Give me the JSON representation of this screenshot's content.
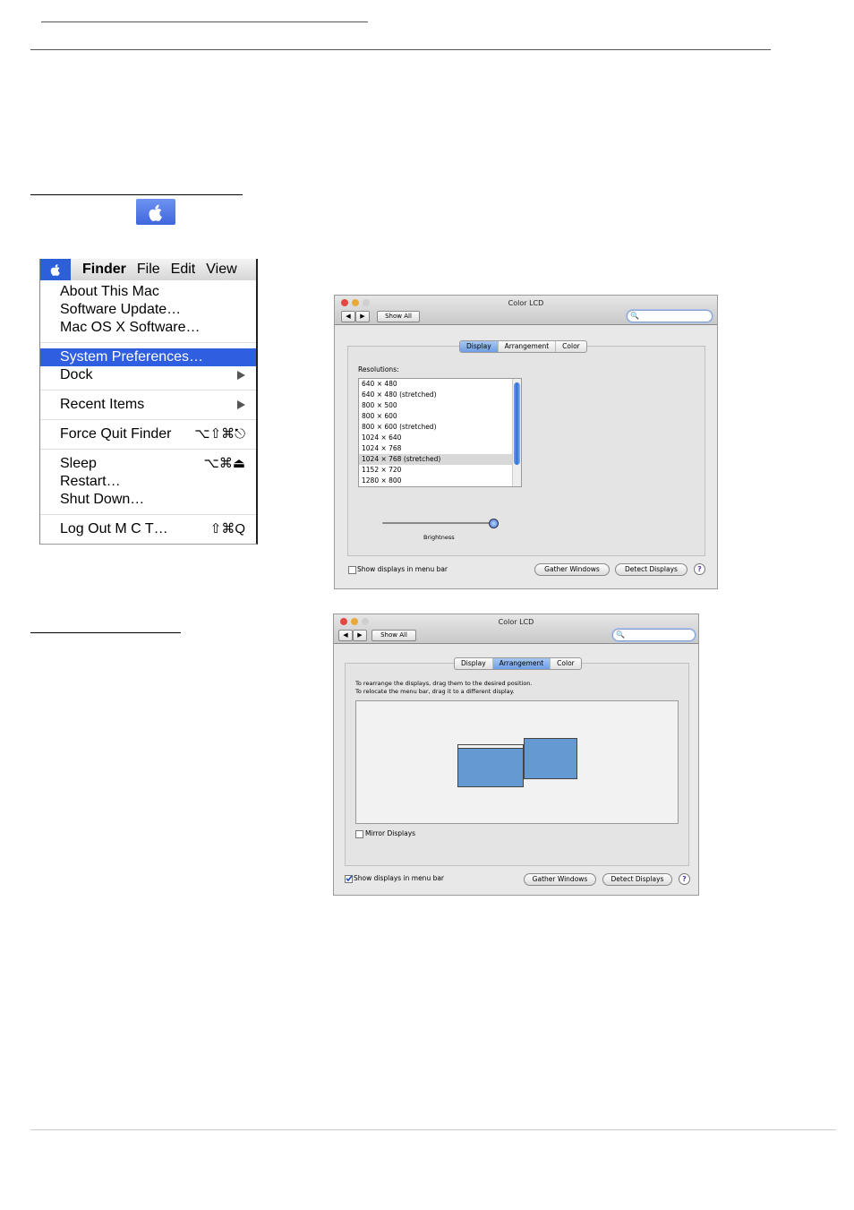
{
  "menu": {
    "bar": {
      "finder": "Finder",
      "file": "File",
      "edit": "Edit",
      "view": "View"
    },
    "items": [
      {
        "label": "About This Mac"
      },
      {
        "label": "Software Update…"
      },
      {
        "label": "Mac OS X Software…"
      },
      {
        "label": "System Preferences…"
      },
      {
        "label": "Dock"
      },
      {
        "label": "Recent Items"
      },
      {
        "label": "Force Quit Finder",
        "shortcut": "⌥⇧⌘⎋"
      },
      {
        "label": "Sleep",
        "shortcut": "⌥⌘⏏"
      },
      {
        "label": "Restart…"
      },
      {
        "label": "Shut Down…"
      },
      {
        "label": "Log Out M C T…",
        "shortcut": "⇧⌘Q"
      }
    ],
    "selected": "System Preferences…"
  },
  "display_window": {
    "title": "Color LCD",
    "show_all": "Show All",
    "tabs": [
      "Display",
      "Arrangement",
      "Color"
    ],
    "active_tab": "Display",
    "resolutions_label": "Resolutions:",
    "resolutions": [
      "640 × 480",
      "640 × 480 (stretched)",
      "800 × 500",
      "800 × 600",
      "800 × 600 (stretched)",
      "1024 × 640",
      "1024 × 768",
      "1024 × 768 (stretched)",
      "1152 × 720",
      "1280 × 800"
    ],
    "selected_resolution": "1024 × 768 (stretched)",
    "brightness_label": "Brightness",
    "brightness_level": 1.0,
    "show_in_menu_bar": "Show displays in menu bar",
    "show_in_menu_bar_checked": false,
    "gather": "Gather Windows",
    "detect": "Detect Displays",
    "help": "?"
  },
  "arrangement_window": {
    "title": "Color LCD",
    "show_all": "Show All",
    "tabs": [
      "Display",
      "Arrangement",
      "Color"
    ],
    "active_tab": "Arrangement",
    "instruction_1": "To rearrange the displays, drag them to the desired position.",
    "instruction_2": "To relocate the menu bar, drag it to a different display.",
    "mirror": "Mirror Displays",
    "mirror_checked": false,
    "show_in_menu_bar": "Show displays in menu bar",
    "show_in_menu_bar_checked": true,
    "gather": "Gather Windows",
    "detect": "Detect Displays",
    "help": "?"
  },
  "colors": {
    "menu_highlight": "#2f5fe0",
    "display_blue": "#6499d2",
    "tab_active": "#7aa6ea"
  }
}
